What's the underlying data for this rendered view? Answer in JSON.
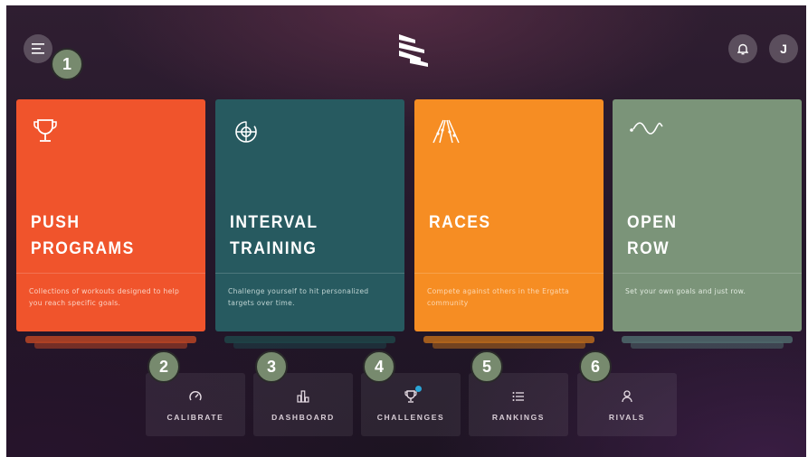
{
  "header": {
    "menu_icon": "hamburger-menu-icon",
    "logo_icon": "ergatta-logo-icon",
    "notifications_icon": "bell-icon",
    "avatar_initial": "J"
  },
  "callouts": [
    "1",
    "2",
    "3",
    "4",
    "5",
    "6"
  ],
  "cards": [
    {
      "title": "PUSH\nPROGRAMS",
      "description": "Collections of workouts designed to help you reach specific goals.",
      "icon": "trophy-icon",
      "color": "#f0542c",
      "stack_color": "#b84424"
    },
    {
      "title": "INTERVAL\nTRAINING",
      "description": "Challenge yourself to hit personalized targets over time.",
      "icon": "target-icon",
      "color": "#275a60",
      "stack_color": "#1e4448"
    },
    {
      "title": "RACES",
      "description": "Compete against others in the Ergatta community",
      "icon": "race-lanes-icon",
      "color": "#f68d23",
      "stack_color": "#b8691c"
    },
    {
      "title": "OPEN\nROW",
      "description": "Set your own goals and just row.",
      "icon": "wave-icon",
      "color": "#7b9479",
      "stack_color": "#4f6a6c"
    }
  ],
  "tabs": [
    {
      "label": "CALIBRATE",
      "icon": "gauge-icon"
    },
    {
      "label": "DASHBOARD",
      "icon": "bar-chart-icon"
    },
    {
      "label": "CHALLENGES",
      "icon": "trophy-icon"
    },
    {
      "label": "RANKINGS",
      "icon": "list-icon"
    },
    {
      "label": "RIVALS",
      "icon": "person-icon"
    }
  ]
}
